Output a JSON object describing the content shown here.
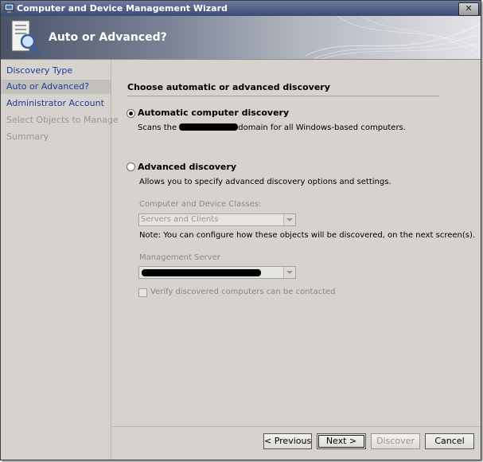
{
  "window": {
    "title": "Computer and Device Management Wizard",
    "close_label": "✕"
  },
  "banner": {
    "title": "Auto or Advanced?"
  },
  "nav": {
    "items": [
      {
        "label": "Discovery Type",
        "state": "enabled"
      },
      {
        "label": "Auto or Advanced?",
        "state": "active"
      },
      {
        "label": "Administrator Account",
        "state": "enabled"
      },
      {
        "label": "Select Objects to Manage",
        "state": "disabled"
      },
      {
        "label": "Summary",
        "state": "disabled"
      }
    ]
  },
  "main": {
    "section_title": "Choose automatic or advanced discovery",
    "automatic": {
      "label": "Automatic computer discovery",
      "selected": true,
      "desc_before": "Scans the ",
      "desc_after": "domain for all Windows-based computers."
    },
    "advanced": {
      "label": "Advanced discovery",
      "selected": false,
      "desc": "Allows you to specify advanced discovery options and settings.",
      "classes_label": "Computer and Device Classes:",
      "classes_value": "Servers and Clients",
      "note": "Note: You can configure how these objects will be discovered, on the next screen(s).",
      "server_label": "Management Server",
      "verify_label": "Verify discovered computers can be contacted",
      "verify_checked": false
    }
  },
  "buttons": {
    "previous": "< Previous",
    "next": "Next >",
    "discover": "Discover",
    "cancel": "Cancel"
  },
  "colors": {
    "nav_link": "#1f3c9a",
    "nav_disabled": "#9a968e",
    "panel_bg": "#d6d3ce",
    "titlebar": "#3b4a73"
  }
}
